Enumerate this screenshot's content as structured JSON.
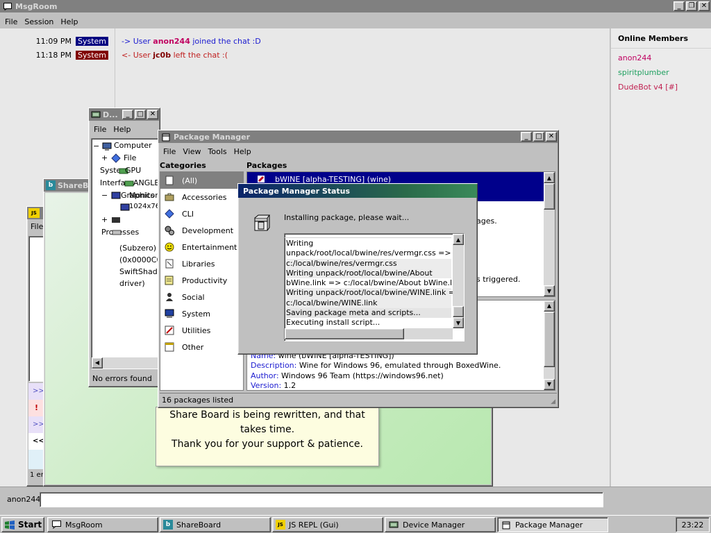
{
  "msgroom": {
    "title": "MsgRoom",
    "menu": [
      "File",
      "Session",
      "Help"
    ],
    "messages": [
      {
        "time": "11:09 PM",
        "tag": "System",
        "tag_color": "#000080",
        "arrow": "->",
        "pre": "User",
        "user": "anon244",
        "user_color": "#c00060",
        "post": "joined the chat :D",
        "color": "#1a1ad0"
      },
      {
        "time": "11:18 PM",
        "tag": "System",
        "tag_color": "#800000",
        "arrow": "<-",
        "pre": "User",
        "user": "jc0b",
        "user_color": "#800000",
        "post": "left the chat :(",
        "color": "#c02020"
      }
    ],
    "members_title": "Online Members",
    "members": [
      {
        "name": "anon244",
        "color": "#c00060"
      },
      {
        "name": "spiritplumber",
        "color": "#20a060"
      },
      {
        "name": "DudeBot v4 [#]",
        "color": "#c02050"
      }
    ],
    "username": "anon244"
  },
  "device_manager": {
    "title": "D...",
    "menu": [
      "File",
      "Help"
    ],
    "tree": [
      "Computer",
      "File",
      "System",
      "GPU",
      "Interface",
      "ANGLE",
      "Graphics",
      "Monitor",
      "1024x768",
      "Processes",
      "(Subzero)",
      "(0x0000C0D",
      "SwiftShade",
      "driver)"
    ],
    "status": "No errors found"
  },
  "shareboard": {
    "title": "ShareB",
    "lines": [
      "Share Board is being rewritten, and that",
      "takes time.",
      "Thank you for your support & patience."
    ]
  },
  "jsrepl": {
    "title": "JS",
    "menu_item": "File",
    "side_items": [
      ">>",
      "!",
      ">>",
      "<<"
    ],
    "status": "1 er"
  },
  "package_manager": {
    "title": "Package Manager",
    "menu": [
      "File",
      "View",
      "Tools",
      "Help"
    ],
    "categories_label": "Categories",
    "packages_label": "Packages",
    "categories": [
      "(All)",
      "Accessories",
      "CLI",
      "Development",
      "Entertainment",
      "Libraries",
      "Productivity",
      "Social",
      "System",
      "Utilities",
      "Other"
    ],
    "selected_package": "bWINE [alpha-TESTING] (wine)",
    "desc_fragments": [
      "ages.",
      "s triggered."
    ],
    "details": {
      "name_label": "Name:",
      "name_value": "wine (bWINE [alpha-TESTING])",
      "desc_label": "Description:",
      "desc_value": "Wine for Windows 96, emulated through BoxedWine.",
      "author_label": "Author:",
      "author_value": "Windows 96 Team (https://windows96.net)",
      "version_label": "Version:",
      "version_value": "1.2"
    },
    "status": "16 packages listed"
  },
  "status_dialog": {
    "title": "Package Manager Status",
    "message": "Installing package, please wait...",
    "log": [
      "Writing",
      "unpack/root/local/bwine/res/vermgr.css =>",
      "c:/local/bwine/res/vermgr.css",
      "Writing unpack/root/local/bwine/About",
      "bWine.link => c:/local/bwine/About bWine.link",
      "Writing unpack/root/local/bwine/WINE.link =>",
      "c:/local/bwine/WINE.link",
      "Saving package meta and scripts...",
      "Executing install script..."
    ]
  },
  "taskbar": {
    "start": "Start",
    "tasks": [
      "MsgRoom",
      "ShareBoard",
      "JS REPL (Gui)",
      "Device Manager",
      "Package Manager"
    ],
    "clock": "23:22"
  }
}
